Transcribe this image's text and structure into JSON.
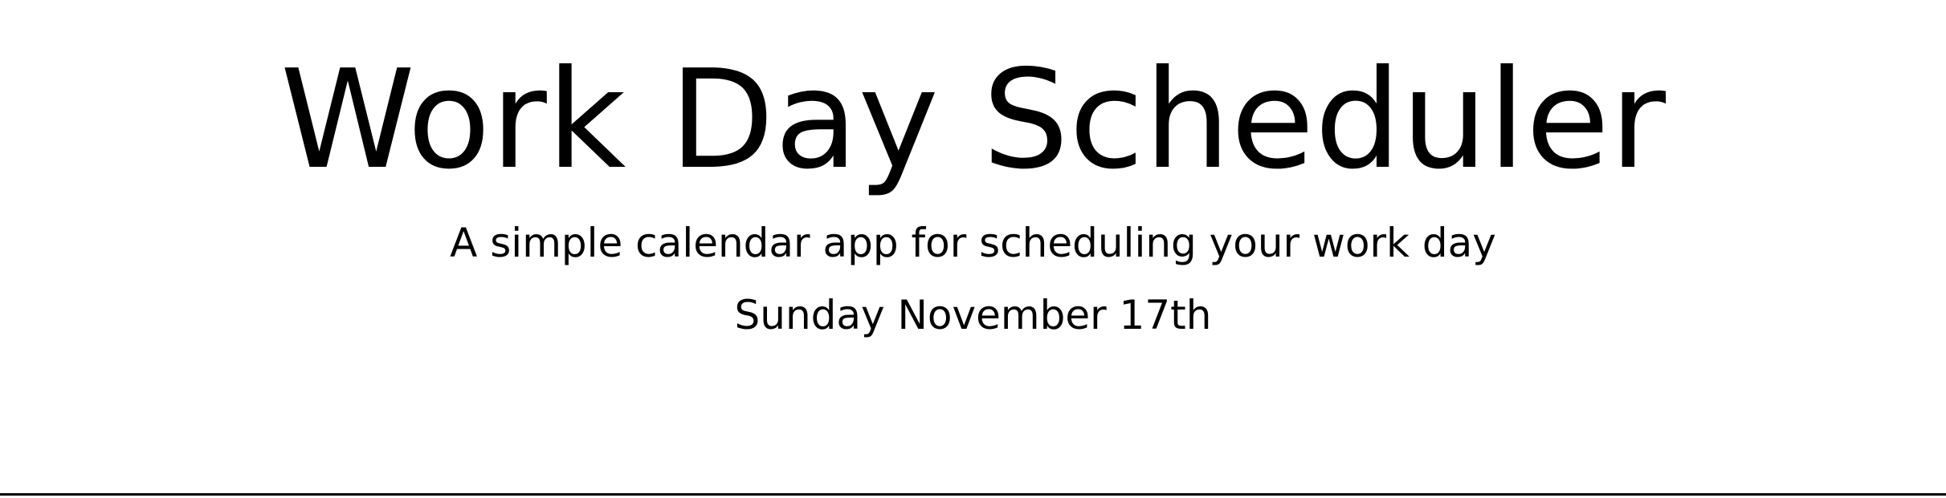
{
  "header": {
    "title": "Work Day Scheduler",
    "subtitle": "A simple calendar app for scheduling your work day",
    "current_day": "Sunday November 17th"
  },
  "colors": {
    "background": "#ffffff",
    "text": "#000000",
    "divider": "#000000"
  }
}
